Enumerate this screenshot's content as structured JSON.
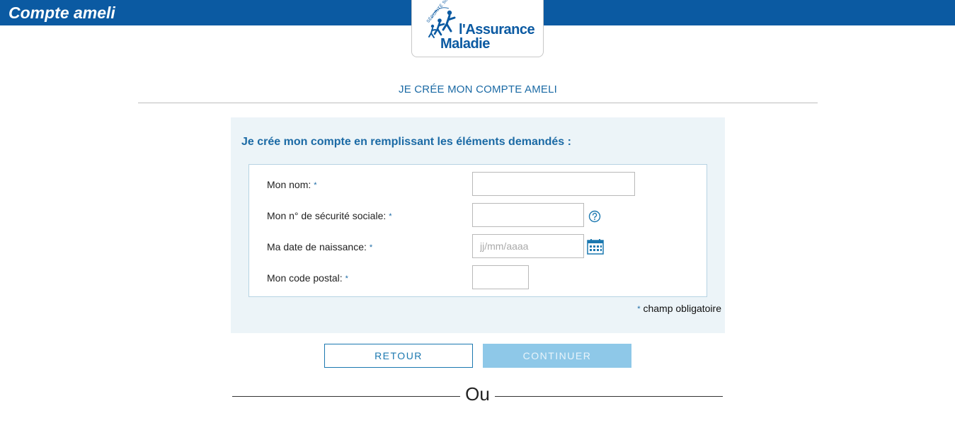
{
  "header": {
    "app_title": "Compte ameli",
    "logo": {
      "tagline": "SÉCURITÉ SOCIALE",
      "line1": "l'Assurance",
      "line2": "Maladie"
    }
  },
  "page": {
    "heading": "JE CRÉE MON COMPTE AMELI"
  },
  "form": {
    "intro": "Je crée mon compte en remplissant les éléments demandés :",
    "required_mark": "*",
    "fields": [
      {
        "label": "Mon nom:",
        "value": "",
        "placeholder": ""
      },
      {
        "label": "Mon n° de sécurité sociale:",
        "value": "",
        "placeholder": ""
      },
      {
        "label": "Ma date de naissance:",
        "value": "",
        "placeholder": "jj/mm/aaaa"
      },
      {
        "label": "Mon code postal:",
        "value": "",
        "placeholder": ""
      }
    ],
    "mandatory_note": "champ obligatoire"
  },
  "actions": {
    "back_label": "RETOUR",
    "continue_label": "CONTINUER"
  },
  "separator": {
    "or_label": "Ou"
  },
  "colors": {
    "brand_blue": "#0b5aa2",
    "link_blue": "#1b6aa5",
    "panel_bg": "#ecf4f8",
    "continue_disabled": "#8ec8e8"
  },
  "icons": {
    "help": "question-circle-icon",
    "calendar": "calendar-icon",
    "logo_figure": "family-figures-icon"
  }
}
